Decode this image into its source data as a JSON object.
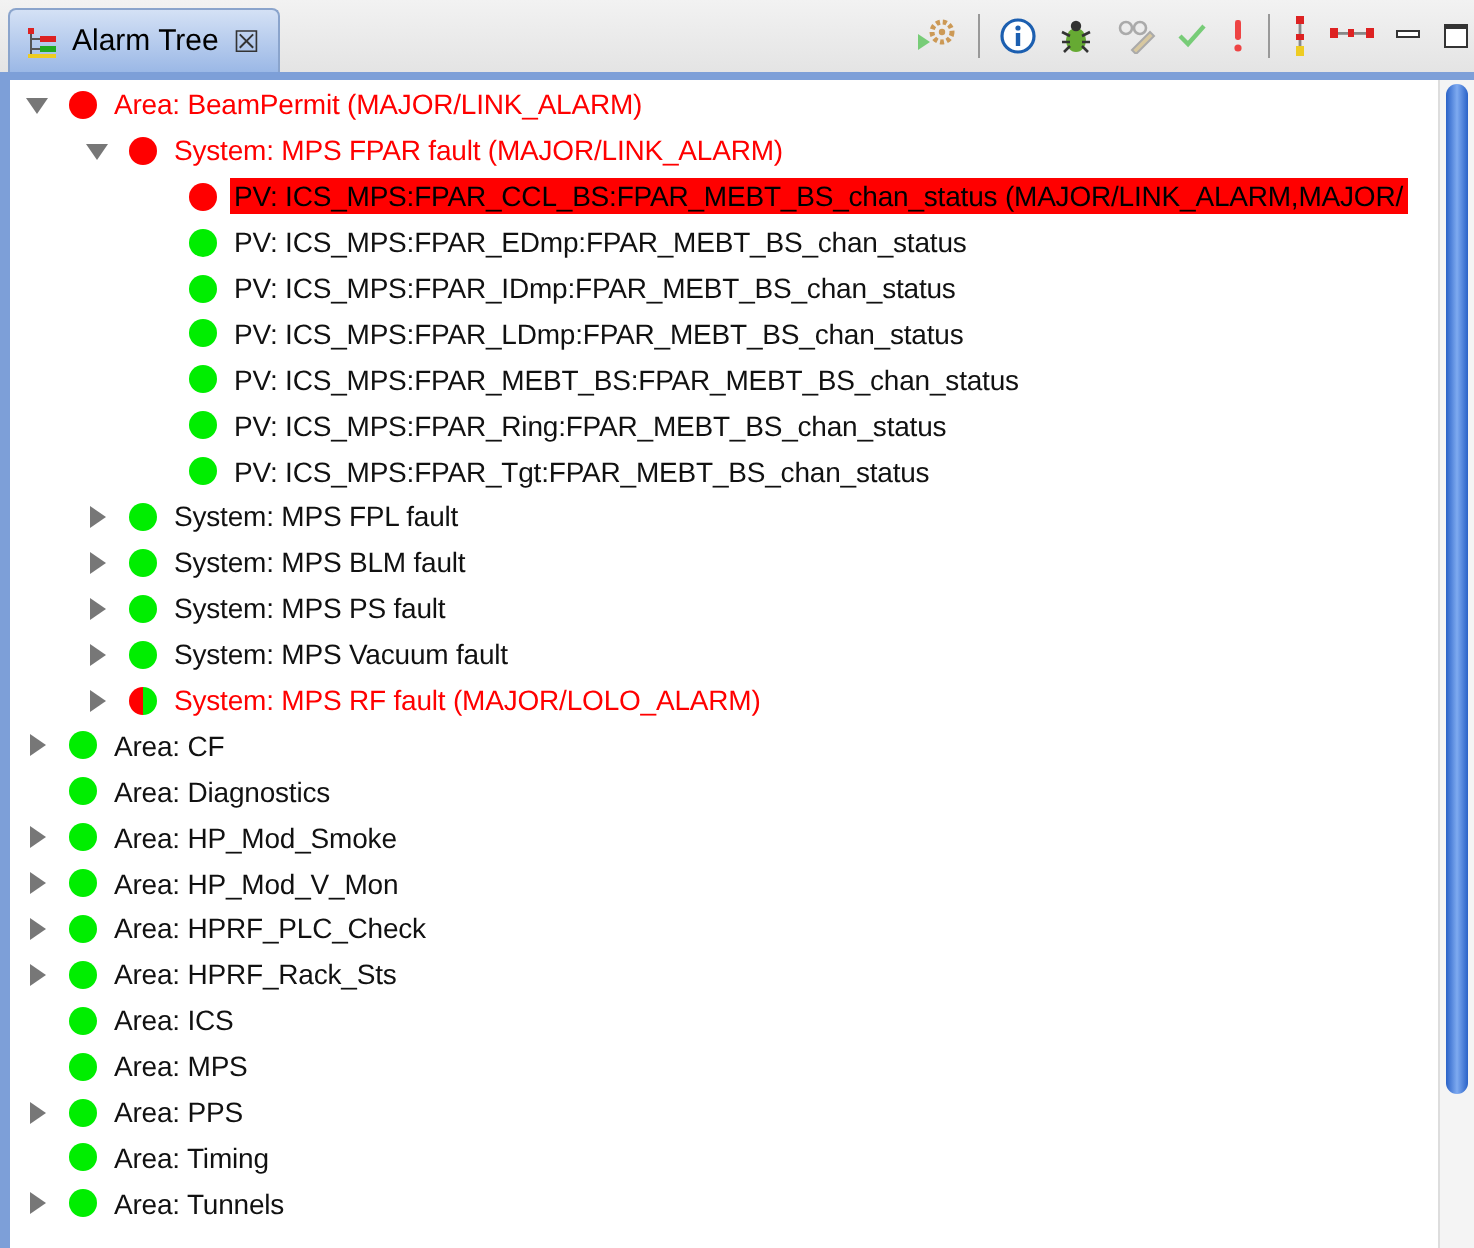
{
  "view": {
    "title": "Alarm Tree",
    "close_glyph": "☒"
  },
  "tree": [
    {
      "label": "Area: BeamPermit (MAJOR/LINK_ALARM)",
      "kind": "alarm",
      "expanded": true,
      "selected": false,
      "children": [
        {
          "label": "System: MPS FPAR fault (MAJOR/LINK_ALARM)",
          "kind": "alarm",
          "expanded": true,
          "selected": false,
          "children": [
            {
              "label": "PV: ICS_MPS:FPAR_CCL_BS:FPAR_MEBT_BS_chan_status (MAJOR/LINK_ALARM,MAJOR/",
              "kind": "alarm",
              "selected": true
            },
            {
              "label": "PV: ICS_MPS:FPAR_EDmp:FPAR_MEBT_BS_chan_status",
              "kind": "ok",
              "selected": false
            },
            {
              "label": "PV: ICS_MPS:FPAR_IDmp:FPAR_MEBT_BS_chan_status",
              "kind": "ok",
              "selected": false
            },
            {
              "label": "PV: ICS_MPS:FPAR_LDmp:FPAR_MEBT_BS_chan_status",
              "kind": "ok",
              "selected": false
            },
            {
              "label": "PV: ICS_MPS:FPAR_MEBT_BS:FPAR_MEBT_BS_chan_status",
              "kind": "ok",
              "selected": false
            },
            {
              "label": "PV: ICS_MPS:FPAR_Ring:FPAR_MEBT_BS_chan_status",
              "kind": "ok",
              "selected": false
            },
            {
              "label": "PV: ICS_MPS:FPAR_Tgt:FPAR_MEBT_BS_chan_status",
              "kind": "ok",
              "selected": false
            }
          ]
        },
        {
          "label": "System: MPS FPL fault",
          "kind": "ok",
          "expanded": false,
          "selected": false
        },
        {
          "label": "System: MPS BLM fault",
          "kind": "ok",
          "expanded": false,
          "selected": false
        },
        {
          "label": "System: MPS PS fault",
          "kind": "ok",
          "expanded": false,
          "selected": false
        },
        {
          "label": "System: MPS Vacuum fault",
          "kind": "ok",
          "expanded": false,
          "selected": false
        },
        {
          "label": "System: MPS RF fault (MAJOR/LOLO_ALARM)",
          "kind": "mixed",
          "expanded": false,
          "selected": false
        }
      ]
    },
    {
      "label": "Area: CF",
      "kind": "ok",
      "expanded": false,
      "selected": false
    },
    {
      "label": "Area: Diagnostics",
      "kind": "ok",
      "selected": false
    },
    {
      "label": "Area: HP_Mod_Smoke",
      "kind": "ok",
      "expanded": false,
      "selected": false
    },
    {
      "label": "Area: HP_Mod_V_Mon",
      "kind": "ok",
      "expanded": false,
      "selected": false
    },
    {
      "label": "Area: HPRF_PLC_Check",
      "kind": "ok",
      "expanded": false,
      "selected": false
    },
    {
      "label": "Area: HPRF_Rack_Sts",
      "kind": "ok",
      "expanded": false,
      "selected": false
    },
    {
      "label": "Area: ICS",
      "kind": "ok",
      "selected": false
    },
    {
      "label": "Area: MPS",
      "kind": "ok",
      "selected": false
    },
    {
      "label": "Area: PPS",
      "kind": "ok",
      "expanded": false,
      "selected": false
    },
    {
      "label": "Area: Timing",
      "kind": "ok",
      "selected": false
    },
    {
      "label": "Area: Tunnels",
      "kind": "ok",
      "expanded": false,
      "selected": false
    }
  ]
}
